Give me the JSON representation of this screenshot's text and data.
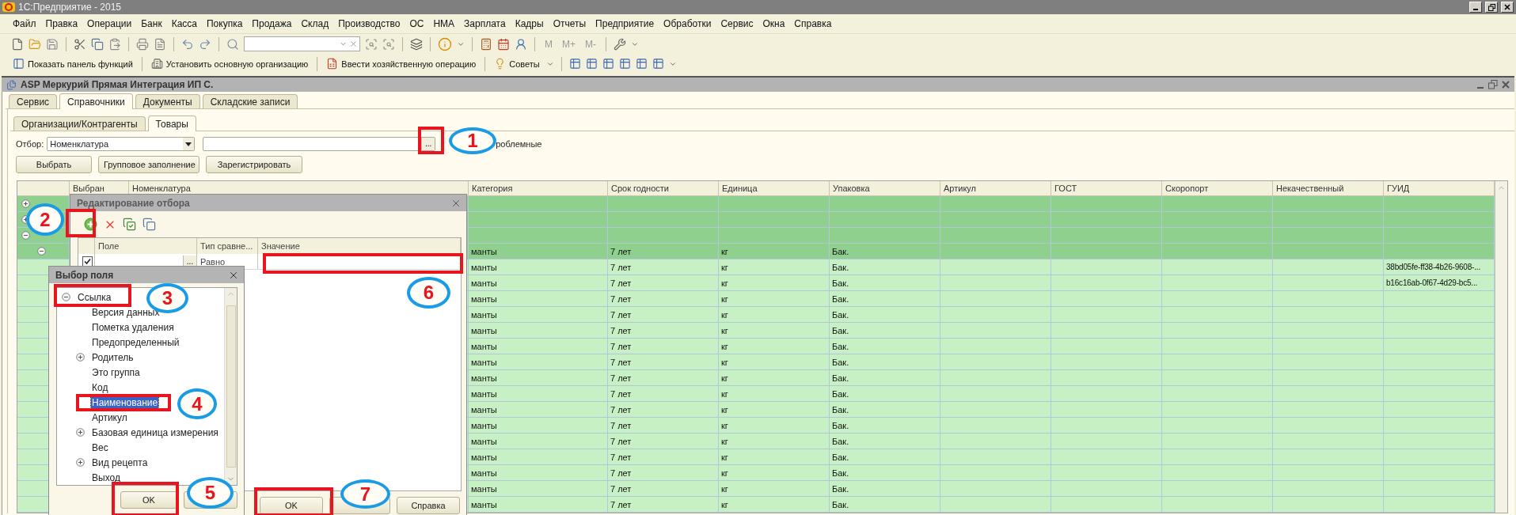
{
  "window": {
    "title": "1С:Предприятие - 2015"
  },
  "menu": [
    "Файл",
    "Правка",
    "Операции",
    "Банк",
    "Касса",
    "Покупка",
    "Продажа",
    "Склад",
    "Производство",
    "ОС",
    "НМА",
    "Зарплата",
    "Кадры",
    "Отчеты",
    "Предприятие",
    "Обработки",
    "Сервис",
    "Окна",
    "Справка"
  ],
  "toolbar": {
    "memory_buttons": [
      {
        "label": "M",
        "disabled": true
      },
      {
        "label": "M+",
        "disabled": true
      },
      {
        "label": "M-",
        "disabled": true
      }
    ]
  },
  "actions_bar": [
    {
      "label": "Показать панель функций",
      "dropdown": false
    },
    {
      "label": "Установить основную организацию",
      "dropdown": false
    },
    {
      "label": "Ввести хозяйственную операцию",
      "dropdown": false
    },
    {
      "label": "Советы",
      "dropdown": true
    }
  ],
  "document": {
    "title": "ASP Меркурий Прямая Интеграция ИП С.",
    "tabs": [
      {
        "label": "Сервис",
        "selected": false
      },
      {
        "label": "Справочники",
        "selected": true
      },
      {
        "label": "Документы",
        "selected": false
      },
      {
        "label": "Складские записи",
        "selected": false
      }
    ],
    "subtabs": [
      {
        "label": "Организации/Контрагенты",
        "selected": false
      },
      {
        "label": "Товары",
        "selected": true
      }
    ],
    "filter": {
      "label": "Отбор:",
      "field": "Номенклатура",
      "choose_button": "...",
      "option_label": "роблемные"
    },
    "buttons": [
      "Выбрать",
      "Групповое заполнение",
      "Зарегистрировать"
    ],
    "table": {
      "columns": [
        "Выбран",
        "Номенклатура",
        "Категория",
        "Срок годности",
        "Единица",
        "Упаковка",
        "Артикул",
        "ГОСТ",
        "Скоропорт",
        "Некачественный",
        "ГУИД"
      ],
      "rows": [
        {
          "kind": "group",
          "expanded": false
        },
        {
          "kind": "group",
          "expanded": false
        },
        {
          "kind": "group",
          "expanded": true,
          "children": [
            {
              "kind": "group",
              "expanded": true,
              "cells": {
                "category": "манты",
                "shelf_life": "7 лет",
                "unit": "кг",
                "package": "Бак."
              },
              "children": [
                {
                  "kind": "item",
                  "cells": {
                    "category": "манты",
                    "shelf_life": "7 лет",
                    "unit": "кг",
                    "package": "Бак.",
                    "guid": "38bd05fe-ff38-4b26-9608-..."
                  }
                },
                {
                  "kind": "item",
                  "cells": {
                    "category": "манты",
                    "shelf_life": "7 лет",
                    "unit": "кг",
                    "package": "Бак.",
                    "guid": "b16c16ab-0f67-4d29-bc5..."
                  }
                },
                {
                  "kind": "item",
                  "cells": {
                    "category": "манты",
                    "shelf_life": "7 лет",
                    "unit": "кг",
                    "package": "Бак."
                  }
                },
                {
                  "kind": "item",
                  "cells": {
                    "category": "манты",
                    "shelf_life": "7 лет",
                    "unit": "кг",
                    "package": "Бак."
                  }
                },
                {
                  "kind": "item",
                  "cells": {
                    "category": "манты",
                    "shelf_life": "7 лет",
                    "unit": "кг",
                    "package": "Бак."
                  }
                },
                {
                  "kind": "item",
                  "cells": {
                    "category": "манты",
                    "shelf_life": "7 лет",
                    "unit": "кг",
                    "package": "Бак."
                  }
                },
                {
                  "kind": "item",
                  "cells": {
                    "category": "манты",
                    "shelf_life": "7 лет",
                    "unit": "кг",
                    "package": "Бак."
                  }
                },
                {
                  "kind": "item",
                  "cells": {
                    "category": "манты",
                    "shelf_life": "7 лет",
                    "unit": "кг",
                    "package": "Бак."
                  }
                },
                {
                  "kind": "item",
                  "cells": {
                    "category": "манты",
                    "shelf_life": "7 лет",
                    "unit": "кг",
                    "package": "Бак."
                  }
                },
                {
                  "kind": "item",
                  "cells": {
                    "category": "манты",
                    "shelf_life": "7 лет",
                    "unit": "кг",
                    "package": "Бак."
                  }
                },
                {
                  "kind": "item",
                  "cells": {
                    "category": "манты",
                    "shelf_life": "7 лет",
                    "unit": "кг",
                    "package": "Бак."
                  }
                },
                {
                  "kind": "item",
                  "cells": {
                    "category": "манты",
                    "shelf_life": "7 лет",
                    "unit": "кг",
                    "package": "Бак."
                  }
                },
                {
                  "kind": "item",
                  "cells": {
                    "category": "манты",
                    "shelf_life": "7 лет",
                    "unit": "кг",
                    "package": "Бак."
                  }
                },
                {
                  "kind": "item",
                  "cells": {
                    "category": "манты",
                    "shelf_life": "7 лет",
                    "unit": "кг",
                    "package": "Бак."
                  }
                },
                {
                  "kind": "item",
                  "cells": {
                    "category": "манты",
                    "shelf_life": "7 лет",
                    "unit": "кг",
                    "package": "Бак."
                  }
                },
                {
                  "kind": "item",
                  "cells": {
                    "category": "манты",
                    "shelf_life": "7 лет",
                    "unit": "кг",
                    "package": "Бак."
                  }
                }
              ]
            }
          ]
        }
      ]
    }
  },
  "filter_dialog": {
    "title": "Редактирование отбора",
    "columns": [
      "Поле",
      "Тип сравне...",
      "Значение"
    ],
    "rows": [
      {
        "checked": true,
        "choose_button": "...",
        "comparison": "Равно"
      }
    ],
    "buttons": [
      {
        "kind": "text",
        "label": "OK"
      },
      {
        "kind": "blank"
      },
      {
        "kind": "text",
        "label": "Справка"
      }
    ]
  },
  "field_dialog": {
    "title": "Выбор поля",
    "tree": [
      {
        "label": "Ссылка",
        "expanded": true,
        "selected": false,
        "children": [
          {
            "label": "Версия данных",
            "selected": false
          },
          {
            "label": "Пометка удаления",
            "selected": false
          },
          {
            "label": "Предопределенный",
            "selected": false
          },
          {
            "label": "Родитель",
            "expanded": false,
            "selected": false
          },
          {
            "label": "Это группа",
            "selected": false
          },
          {
            "label": "Код",
            "selected": false
          },
          {
            "label": "Наименование",
            "selected": true
          },
          {
            "label": "Артикул",
            "selected": false
          },
          {
            "label": "Базовая единица измерения",
            "expanded": false,
            "selected": false
          },
          {
            "label": "Вес",
            "selected": false
          },
          {
            "label": "Вид рецепта",
            "expanded": false,
            "selected": false
          },
          {
            "label": "Выход",
            "selected": false
          }
        ]
      }
    ],
    "buttons": [
      {
        "kind": "text",
        "label": "OK"
      },
      {
        "kind": "blank"
      }
    ]
  },
  "annotations": [
    {
      "label": "1"
    },
    {
      "label": "2"
    },
    {
      "label": "3"
    },
    {
      "label": "4"
    },
    {
      "label": "5"
    },
    {
      "label": "6"
    },
    {
      "label": "7"
    }
  ]
}
